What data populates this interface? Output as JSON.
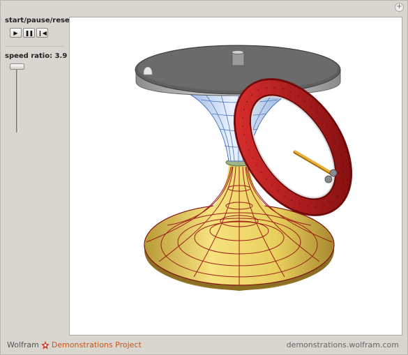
{
  "controls": {
    "play_label": "start/pause/reset",
    "speed_label": "speed ratio:",
    "speed_value": "3.9",
    "speed_level": 0.06
  },
  "icons": {
    "play": "play-icon",
    "pause": "pause-icon",
    "reset": "reset-icon",
    "expand": "plus-icon",
    "brand": "wolfram-spikey-icon"
  },
  "footer": {
    "brand_name": "Wolfram",
    "brand_project": "Demonstrations Project",
    "url": "demonstrations.wolfram.com"
  },
  "colors": {
    "disk_top": "#6b6b6b",
    "disk_rim": "#a9a9a9",
    "cone_upper": "#aac8ee",
    "cone_lower": "#f2e07a",
    "grid_red": "#9a1515",
    "wheel_red": "#c01818",
    "axle": "#f0b030"
  }
}
